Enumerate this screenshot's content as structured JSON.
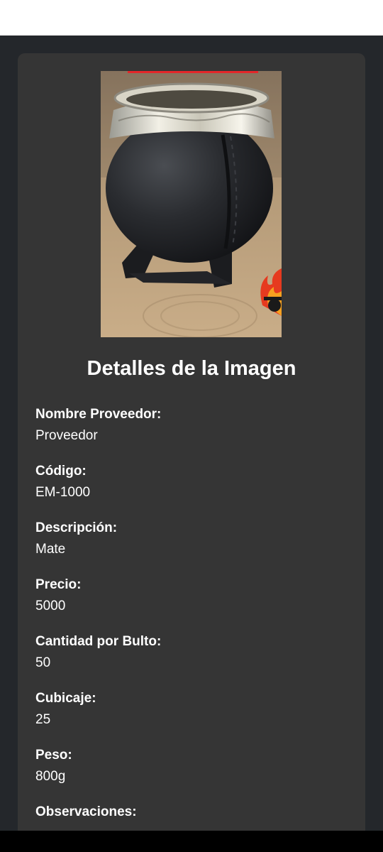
{
  "page": {
    "title": "Detalles de la Imagen"
  },
  "product_image": {
    "alt": "Mate de cuero negro con virola de alpaca",
    "logo_icon": "flame-mascot-logo-icon"
  },
  "details": [
    {
      "label": "Nombre Proveedor:",
      "value": "Proveedor"
    },
    {
      "label": "Código:",
      "value": "EM-1000"
    },
    {
      "label": "Descripción:",
      "value": "Mate"
    },
    {
      "label": "Precio:",
      "value": "5000"
    },
    {
      "label": "Cantidad por Bulto:",
      "value": "50"
    },
    {
      "label": "Cubicaje:",
      "value": "25"
    },
    {
      "label": "Peso:",
      "value": "800g"
    },
    {
      "label": "Observaciones:",
      "value": ""
    }
  ],
  "colors": {
    "background": "#24272b",
    "card": "#353535",
    "text": "#ffffff",
    "accent": "#e3262a"
  }
}
